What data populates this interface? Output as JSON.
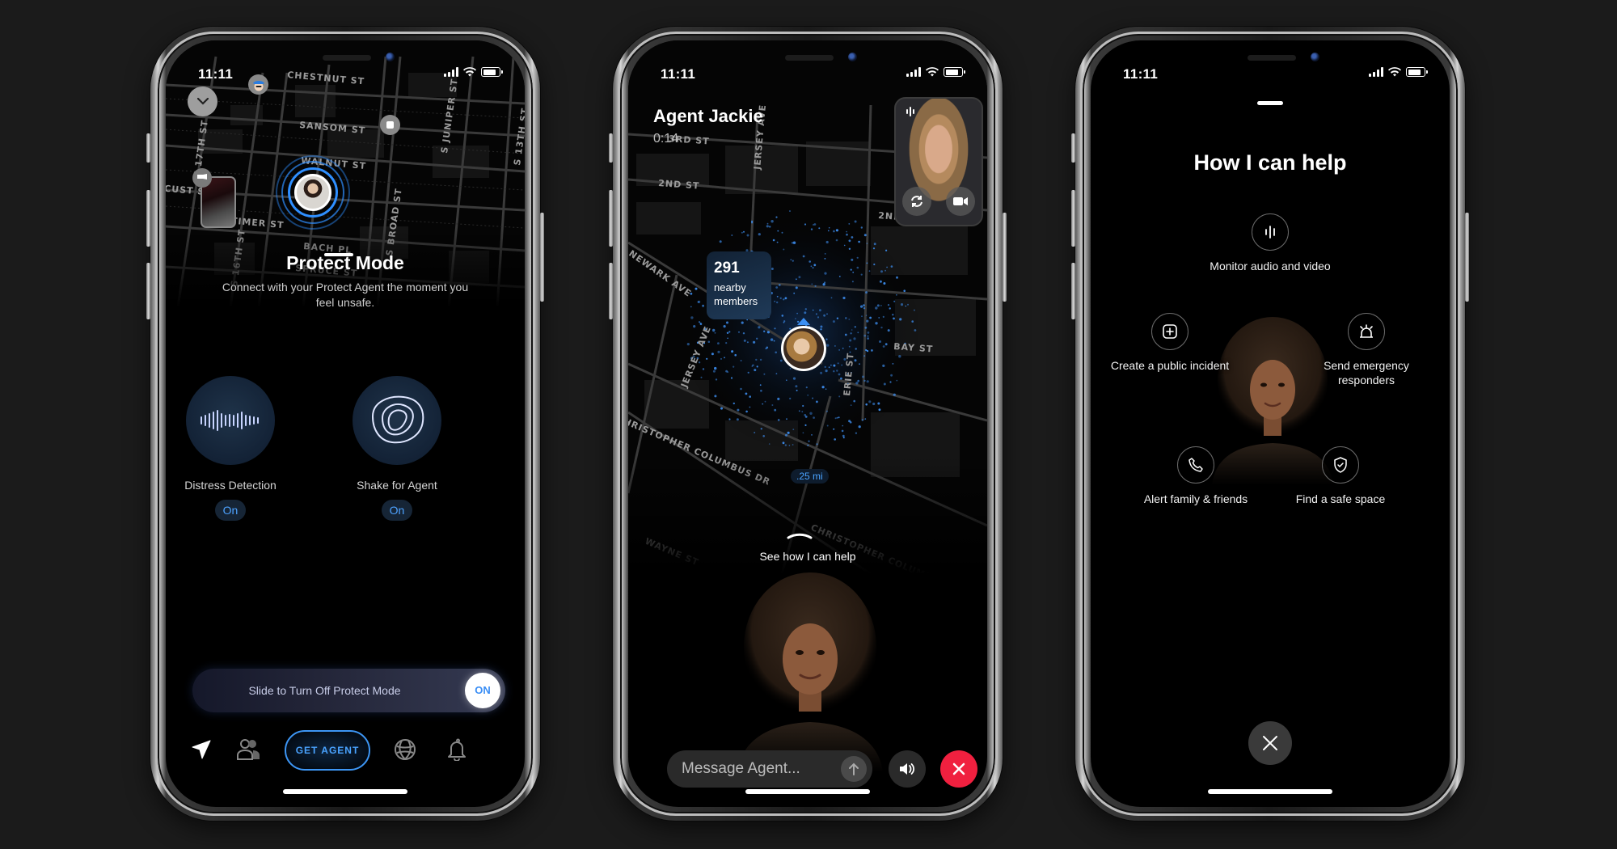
{
  "status_bar": {
    "time": "11:11"
  },
  "screen1": {
    "map_streets": [
      "CHESTNUT ST",
      "SANSOM ST",
      "WALNUT ST",
      "LOCUST ST",
      "LATIMER ST",
      "BACH PL",
      "SPRUCE ST",
      "S 17TH ST",
      "S 16TH ST",
      "S BROAD ST",
      "S JUNIPER ST",
      "S 13TH ST"
    ],
    "title": "Protect Mode",
    "subtitle": "Connect with your Protect Agent the moment you feel unsafe.",
    "features": [
      {
        "label": "Distress Detection",
        "state": "On",
        "icon": "soundwave-icon"
      },
      {
        "label": "Shake for Agent",
        "state": "On",
        "icon": "shake-rings-icon"
      }
    ],
    "slider": {
      "label": "Slide to Turn Off Protect Mode",
      "knob": "ON"
    },
    "tabbar": {
      "items": [
        {
          "icon": "location-arrow-icon",
          "active": true
        },
        {
          "icon": "people-icon",
          "active": false
        },
        {
          "label": "GET AGENT"
        },
        {
          "icon": "globe-icon",
          "active": false
        },
        {
          "icon": "bell-icon",
          "active": false
        }
      ]
    },
    "accent_color": "#3d96f5"
  },
  "screen2": {
    "agent_name": "Agent Jackie",
    "call_timer": "0:14",
    "map_streets": [
      "3RD ST",
      "2ND ST",
      "JERSEY AVE",
      "NEWARK AVE",
      "ERIE ST",
      "BAY ST",
      "CHRISTOPHER COLUMBUS DR",
      "WAYNE ST"
    ],
    "members": {
      "count": "291",
      "label": "nearby members"
    },
    "distance": ".25 mi",
    "see_help": "See how I can help",
    "message_placeholder": "Message Agent...",
    "end_call_color": "#f0203f"
  },
  "screen3": {
    "title": "How I can help",
    "items": [
      {
        "label": "Monitor audio and video",
        "icon": "audio-bars-icon"
      },
      {
        "label": "Create a public incident",
        "icon": "plus-square-icon"
      },
      {
        "label": "Send emergency responders",
        "icon": "siren-icon"
      },
      {
        "label": "Alert family & friends",
        "icon": "phone-icon"
      },
      {
        "label": "Find a safe space",
        "icon": "shield-check-icon"
      }
    ]
  }
}
